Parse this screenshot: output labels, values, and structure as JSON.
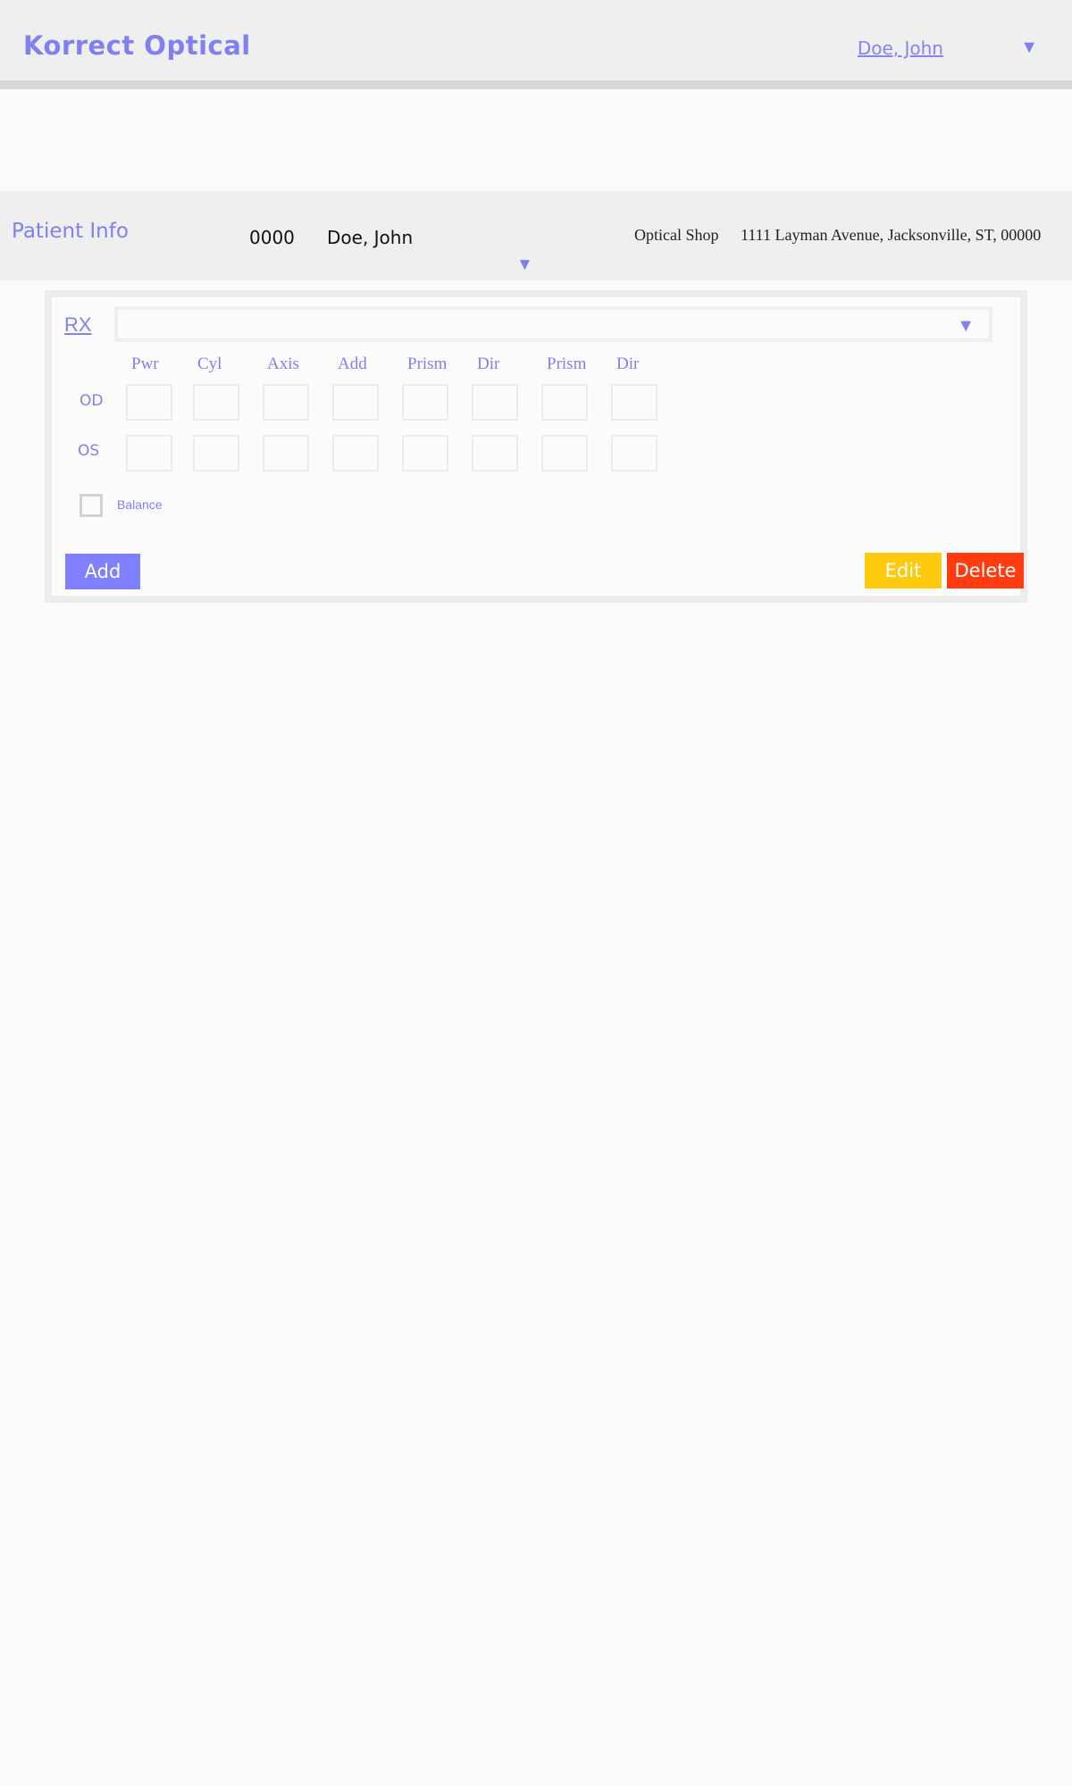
{
  "header": {
    "brand": "Korrect Optical",
    "user_name": "Doe, John",
    "user_menu_icon": "chevron-down-icon"
  },
  "patient": {
    "title": "Patient Info",
    "id": "0000",
    "name": "Doe, John",
    "shop_label": "Optical Shop",
    "shop_address": "1111 Layman Avenue, Jacksonville, ST, 00000",
    "expand_icon": "chevron-down-icon"
  },
  "rx": {
    "title": "RX",
    "select_value": "",
    "select_icon": "chevron-down-icon",
    "columns": [
      "Pwr",
      "Cyl",
      "Axis",
      "Add",
      "Prism",
      "Dir",
      "Prism",
      "Dir"
    ],
    "rows": [
      {
        "label": "OD",
        "values": [
          "",
          "",
          "",
          "",
          "",
          "",
          "",
          ""
        ]
      },
      {
        "label": "OS",
        "values": [
          "",
          "",
          "",
          "",
          "",
          "",
          "",
          ""
        ]
      }
    ],
    "balance_label": "Balance",
    "balance_checked": false,
    "add_label": "Add",
    "edit_label": "Edit",
    "delete_label": "Delete"
  },
  "colors": {
    "accent": "#8080f0",
    "edit": "#ffc90d",
    "delete": "#ff3b0f",
    "add": "#8080ff"
  }
}
